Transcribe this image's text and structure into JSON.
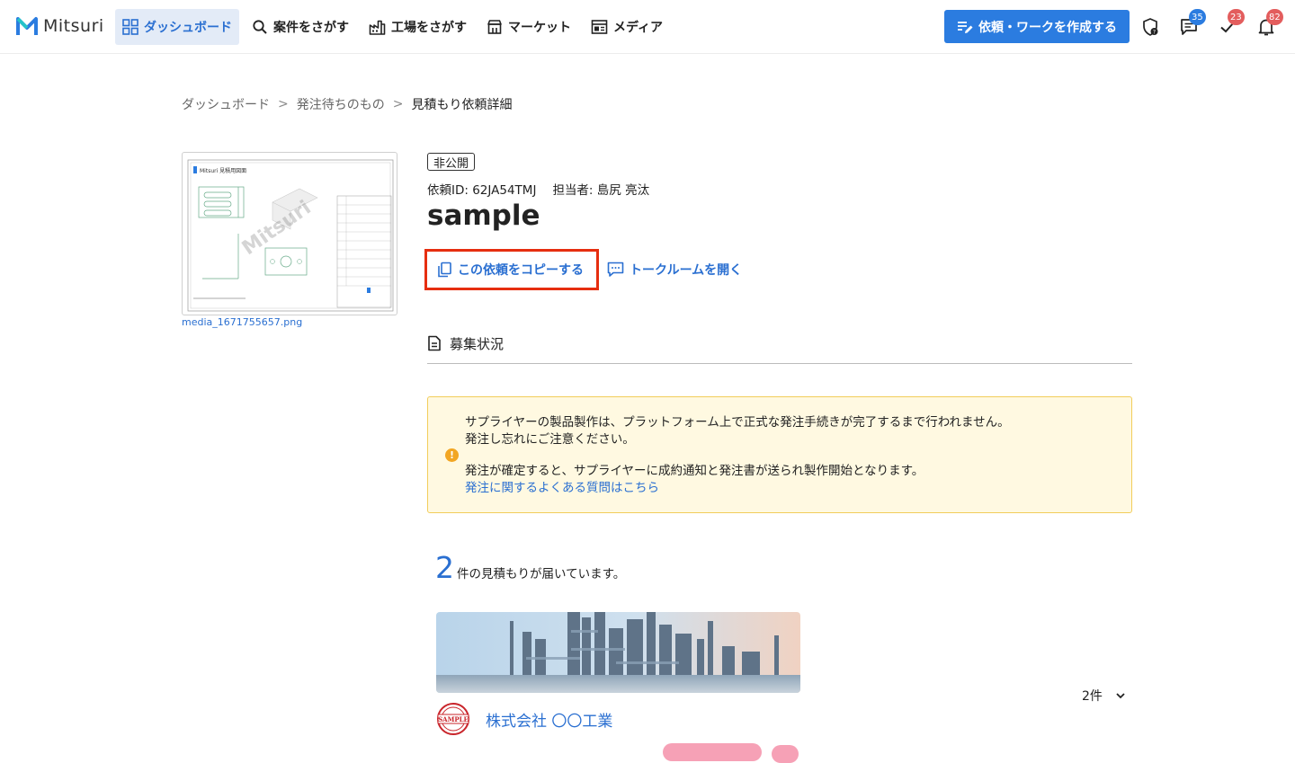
{
  "header": {
    "logo_text": "Mitsuri",
    "nav": [
      {
        "label": "ダッシュボード",
        "active": true
      },
      {
        "label": "案件をさがす"
      },
      {
        "label": "工場をさがす"
      },
      {
        "label": "マーケット"
      },
      {
        "label": "メディア"
      }
    ],
    "create_button": "依頼・ワークを作成する",
    "badges": {
      "messages": "35",
      "tasks": "23",
      "notifications": "82"
    },
    "colors": {
      "accent": "#2b7ce0",
      "badge_red": "#e35d5d"
    }
  },
  "breadcrumb": [
    "ダッシュボード",
    "発注待ちのもの",
    "見積もり依頼詳細"
  ],
  "attachment": {
    "filename": "media_1671755657.png",
    "drawing_logo_text": "Mitsuri 見積用図面",
    "watermark": "Mitsuri"
  },
  "request": {
    "status": "非公開",
    "id_text": "依頼ID: 62JA54TMJ",
    "owner_text": "担当者: 島尻 亮汰",
    "title": "sample",
    "copy_link": "この依頼をコピーする",
    "talk_link": "トークルームを開く"
  },
  "section": {
    "title": "募集状況"
  },
  "notice": {
    "line1": "サプライヤーの製品製作は、プラットフォーム上で正式な発注手続きが完了するまで行われません。",
    "line2": "発注し忘れにご注意ください。",
    "line3": "発注が確定すると、サプライヤーに成約通知と発注書が送られ製作開始となります。",
    "link": "発注に関するよくある質問はこちら"
  },
  "quotes": {
    "count": "2",
    "suffix": "件の見積もりが届いています。",
    "select_value": "2件",
    "company_name": "株式会社 〇〇工業",
    "stamp_text": "SAMPLE"
  }
}
